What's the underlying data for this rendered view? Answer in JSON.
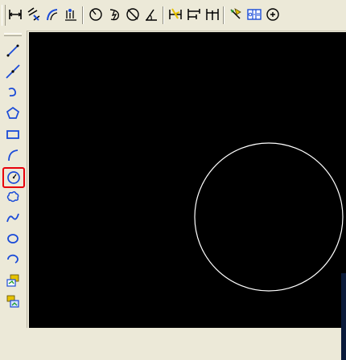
{
  "top_toolbar": {
    "buttons": [
      {
        "icon": "linear-dimension-icon"
      },
      {
        "icon": "aligned-dimension-icon"
      },
      {
        "icon": "arc-length-dimension-icon"
      },
      {
        "icon": "ordinate-dimension-icon"
      },
      {
        "icon": "radius-dimension-icon"
      },
      {
        "icon": "jogged-dimension-icon"
      },
      {
        "icon": "diameter-dimension-icon"
      },
      {
        "icon": "angular-dimension-icon"
      },
      {
        "icon": "quick-dimension-icon"
      },
      {
        "icon": "baseline-dimension-icon"
      },
      {
        "icon": "continue-dimension-icon"
      },
      {
        "icon": "quick-leader-icon"
      },
      {
        "icon": "tolerance-icon"
      },
      {
        "icon": "center-mark-icon"
      }
    ]
  },
  "left_toolbar": {
    "buttons": [
      {
        "icon": "line-icon"
      },
      {
        "icon": "construction-line-icon"
      },
      {
        "icon": "polyline-icon"
      },
      {
        "icon": "polygon-icon"
      },
      {
        "icon": "rectangle-icon"
      },
      {
        "icon": "arc-icon"
      },
      {
        "icon": "circle-icon",
        "highlighted": true
      },
      {
        "icon": "revision-cloud-icon"
      },
      {
        "icon": "spline-icon"
      },
      {
        "icon": "ellipse-icon"
      },
      {
        "icon": "ellipse-arc-icon"
      },
      {
        "icon": "insert-block-icon"
      },
      {
        "icon": "make-block-icon"
      }
    ]
  },
  "drawing": {
    "background": "#000000",
    "stroke": "#ffffff",
    "highlight_color": "#e8000b",
    "entities": [
      {
        "type": "circle",
        "label": "circle"
      }
    ]
  }
}
